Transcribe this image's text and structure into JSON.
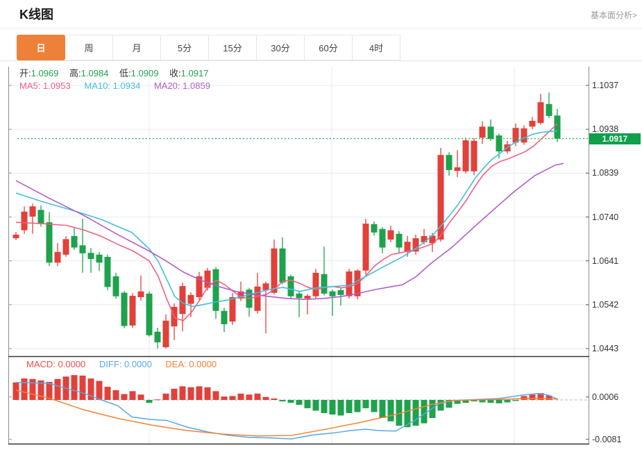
{
  "header": {
    "title": "K线图",
    "link": "基本面分析>"
  },
  "tabs": {
    "items": [
      {
        "label": "日",
        "active": true
      },
      {
        "label": "周",
        "active": false
      },
      {
        "label": "月",
        "active": false
      },
      {
        "label": "5分",
        "active": false
      },
      {
        "label": "15分",
        "active": false
      },
      {
        "label": "30分",
        "active": false
      },
      {
        "label": "60分",
        "active": false
      },
      {
        "label": "4时",
        "active": false
      }
    ]
  },
  "legend": {
    "open_label": "开:",
    "open": "1.0969",
    "high_label": "高:",
    "high": "1.0984",
    "low_label": "低:",
    "low": "1.0909",
    "close_label": "收:",
    "close": "1.0917",
    "ma5_label": "MA5:",
    "ma5": "1.0953",
    "ma10_label": "MA10:",
    "ma10": "1.0934",
    "ma20_label": "MA20:",
    "ma20": "1.0859"
  },
  "macd_legend": {
    "macd_label": "MACD:",
    "macd": "0.0000",
    "diff_label": "DIFF:",
    "diff": "0.0000",
    "dea_label": "DEA:",
    "dea": "0.0000"
  },
  "colors": {
    "up": "#e2403a",
    "down": "#1ea24c",
    "ma5": "#f06080",
    "ma10": "#41bfdc",
    "ma20": "#b45cc8",
    "price_line": "#2db553",
    "badge_bg": "#0fa04a",
    "diff": "#57a8e8",
    "dea": "#f58231",
    "macd_label": "#f24b4b",
    "accent": "#ee8139",
    "value_green": "#21a44d",
    "grid": "#e6ebf0",
    "axis": "#8a8a8a",
    "frame_dark": "#333333",
    "zero_dash": "#aacbe8"
  },
  "chart_data": {
    "type": "candlestick",
    "title": "K线图",
    "price_axis": {
      "labels": [
        "1.1037",
        "1.0938",
        "1.0839",
        "1.0740",
        "1.0641",
        "1.0542",
        "1.0443"
      ],
      "ylim": [
        1.0443,
        1.1037
      ],
      "current_price": "1.0917"
    },
    "macd_axis": {
      "labels": [
        "0.0006",
        "-0.0081"
      ],
      "values": [
        0.0006,
        -0.0081
      ]
    },
    "candles": [
      [
        1.0692,
        1.0706,
        1.0688,
        1.07
      ],
      [
        1.071,
        1.0764,
        1.0702,
        1.0752
      ],
      [
        1.0741,
        1.077,
        1.0702,
        1.0764
      ],
      [
        1.0756,
        1.0766,
        1.0718,
        1.0724
      ],
      [
        1.0728,
        1.0751,
        1.0629,
        1.0637
      ],
      [
        1.0637,
        1.0681,
        1.0629,
        1.0661
      ],
      [
        1.0655,
        1.0697,
        1.065,
        1.069
      ],
      [
        1.0697,
        1.0717,
        1.0666,
        1.0671
      ],
      [
        1.0676,
        1.0736,
        1.0614,
        1.0658
      ],
      [
        1.0659,
        1.067,
        1.0614,
        1.0645
      ],
      [
        1.0655,
        1.0661,
        1.0618,
        1.0637
      ],
      [
        1.065,
        1.0655,
        1.0575,
        1.0582
      ],
      [
        1.0606,
        1.0614,
        1.0556,
        1.0561
      ],
      [
        1.0569,
        1.0573,
        1.0489,
        1.0494
      ],
      [
        1.0495,
        1.0568,
        1.049,
        1.0562
      ],
      [
        1.0559,
        1.0608,
        1.0551,
        1.0572
      ],
      [
        1.0567,
        1.0572,
        1.047,
        1.0473
      ],
      [
        1.0481,
        1.049,
        1.0443,
        1.0457
      ],
      [
        1.0446,
        1.052,
        1.0443,
        1.0506
      ],
      [
        1.0493,
        1.0545,
        1.0462,
        1.0537
      ],
      [
        1.0521,
        1.0592,
        1.0482,
        1.0584
      ],
      [
        1.0544,
        1.057,
        1.0514,
        1.0564
      ],
      [
        1.0559,
        1.0616,
        1.0553,
        1.0606
      ],
      [
        1.058,
        1.0625,
        1.0574,
        1.0619
      ],
      [
        1.0622,
        1.0627,
        1.051,
        1.0528
      ],
      [
        1.0528,
        1.0535,
        1.048,
        1.0498
      ],
      [
        1.0504,
        1.0568,
        1.0496,
        1.0559
      ],
      [
        1.0556,
        1.0594,
        1.055,
        1.0572
      ],
      [
        1.0576,
        1.058,
        1.0515,
        1.0535
      ],
      [
        1.0528,
        1.0614,
        1.0522,
        1.0583
      ],
      [
        1.0575,
        1.0594,
        1.0477,
        1.059
      ],
      [
        1.0569,
        1.0689,
        1.0565,
        1.0669
      ],
      [
        1.0669,
        1.0694,
        1.0588,
        1.0592
      ],
      [
        1.0606,
        1.061,
        1.0555,
        1.0561
      ],
      [
        1.0567,
        1.0572,
        1.0514,
        1.0557
      ],
      [
        1.0556,
        1.0566,
        1.052,
        1.0562
      ],
      [
        1.0561,
        1.0623,
        1.0556,
        1.0614
      ],
      [
        1.0611,
        1.0673,
        1.0563,
        1.0567
      ],
      [
        1.0572,
        1.0576,
        1.0517,
        1.0561
      ],
      [
        1.0575,
        1.0579,
        1.054,
        1.0564
      ],
      [
        1.0561,
        1.0623,
        1.0556,
        1.0617
      ],
      [
        1.0561,
        1.0622,
        1.0554,
        1.0619
      ],
      [
        1.0619,
        1.0736,
        1.061,
        1.0725
      ],
      [
        1.0724,
        1.073,
        1.0698,
        1.0705
      ],
      [
        1.0713,
        1.0717,
        1.0658,
        1.0671
      ],
      [
        1.0689,
        1.072,
        1.0683,
        1.071
      ],
      [
        1.0702,
        1.0708,
        1.0658,
        1.0671
      ],
      [
        1.0661,
        1.0697,
        1.065,
        1.0684
      ],
      [
        1.0662,
        1.07,
        1.0655,
        1.0692
      ],
      [
        1.0683,
        1.0713,
        1.0678,
        1.0697
      ],
      [
        1.0681,
        1.0704,
        1.0661,
        1.0698
      ],
      [
        1.0689,
        1.0896,
        1.0684,
        1.088
      ],
      [
        1.088,
        1.0886,
        1.0833,
        1.0846
      ],
      [
        1.0844,
        1.0891,
        1.083,
        1.0852
      ],
      [
        1.0843,
        1.0919,
        1.0838,
        1.0913
      ],
      [
        1.0843,
        1.0918,
        1.0835,
        1.0912
      ],
      [
        1.0919,
        1.0956,
        1.0905,
        1.0944
      ],
      [
        1.0944,
        1.096,
        1.0912,
        1.0916
      ],
      [
        1.0924,
        1.0928,
        1.0872,
        1.0888
      ],
      [
        1.0888,
        1.0912,
        1.0883,
        1.0904
      ],
      [
        1.0908,
        1.0951,
        1.09,
        1.0941
      ],
      [
        1.0908,
        1.0947,
        1.0903,
        1.094
      ],
      [
        1.0944,
        1.0966,
        1.0938,
        1.0957
      ],
      [
        1.0952,
        1.1018,
        1.0948,
        1.0999
      ],
      [
        1.0995,
        1.1021,
        1.0963,
        1.0968
      ],
      [
        1.0969,
        1.0984,
        1.0909,
        1.0917
      ]
    ],
    "ma_lines": [
      {
        "name": "MA5",
        "points": [
          [
            23,
            1.0728
          ],
          [
            60,
            1.0725
          ],
          [
            96,
            1.0721
          ],
          [
            120,
            1.0711
          ],
          [
            145,
            1.0697
          ],
          [
            170,
            1.0678
          ],
          [
            192,
            1.0663
          ],
          [
            215,
            1.0641
          ],
          [
            228,
            1.0606
          ],
          [
            240,
            1.0556
          ],
          [
            252,
            1.0512
          ],
          [
            264,
            1.0506
          ],
          [
            276,
            1.0525
          ],
          [
            288,
            1.0553
          ],
          [
            300,
            1.0584
          ],
          [
            312,
            1.0597
          ],
          [
            324,
            1.0587
          ],
          [
            336,
            1.0572
          ],
          [
            348,
            1.0559
          ],
          [
            360,
            1.0556
          ],
          [
            372,
            1.0561
          ],
          [
            384,
            1.0565
          ],
          [
            396,
            1.0578
          ],
          [
            408,
            1.0595
          ],
          [
            420,
            1.0597
          ],
          [
            432,
            1.059
          ],
          [
            444,
            1.0581
          ],
          [
            456,
            1.0576
          ],
          [
            468,
            1.0581
          ],
          [
            480,
            1.0583
          ],
          [
            492,
            1.058
          ],
          [
            504,
            1.0583
          ],
          [
            516,
            1.059
          ],
          [
            528,
            1.0609
          ],
          [
            540,
            1.063
          ],
          [
            552,
            1.0644
          ],
          [
            564,
            1.0655
          ],
          [
            576,
            1.0659
          ],
          [
            588,
            1.0663
          ],
          [
            600,
            1.0667
          ],
          [
            612,
            1.0673
          ],
          [
            624,
            1.068
          ],
          [
            636,
            1.07
          ],
          [
            648,
            1.0728
          ],
          [
            660,
            1.0752
          ],
          [
            672,
            1.0778
          ],
          [
            684,
            1.0808
          ],
          [
            696,
            1.0835
          ],
          [
            708,
            1.0854
          ],
          [
            720,
            1.0865
          ],
          [
            732,
            1.0871
          ],
          [
            744,
            1.0879
          ],
          [
            756,
            1.0887
          ],
          [
            768,
            1.0899
          ],
          [
            780,
            1.0916
          ],
          [
            792,
            1.0934
          ],
          [
            803,
            1.095
          ]
        ]
      },
      {
        "name": "MA10",
        "points": [
          [
            23,
            1.0794
          ],
          [
            60,
            1.0775
          ],
          [
            100,
            1.0757
          ],
          [
            145,
            1.0735
          ],
          [
            190,
            1.0705
          ],
          [
            215,
            1.0668
          ],
          [
            228,
            1.064
          ],
          [
            240,
            1.06
          ],
          [
            252,
            1.056
          ],
          [
            264,
            1.0545
          ],
          [
            278,
            1.0538
          ],
          [
            292,
            1.0542
          ],
          [
            310,
            1.0548
          ],
          [
            330,
            1.0553
          ],
          [
            350,
            1.0561
          ],
          [
            372,
            1.057
          ],
          [
            390,
            1.0577
          ],
          [
            408,
            1.0581
          ],
          [
            432,
            1.0572
          ],
          [
            456,
            1.058
          ],
          [
            480,
            1.0583
          ],
          [
            504,
            1.0586
          ],
          [
            527,
            1.0606
          ],
          [
            553,
            1.0628
          ],
          [
            580,
            1.065
          ],
          [
            600,
            1.067
          ],
          [
            612,
            1.0684
          ],
          [
            624,
            1.07
          ],
          [
            636,
            1.0721
          ],
          [
            648,
            1.0744
          ],
          [
            660,
            1.0768
          ],
          [
            672,
            1.0797
          ],
          [
            684,
            1.0826
          ],
          [
            696,
            1.0849
          ],
          [
            708,
            1.0869
          ],
          [
            720,
            1.0883
          ],
          [
            732,
            1.0898
          ],
          [
            744,
            1.091
          ],
          [
            756,
            1.0919
          ],
          [
            768,
            1.0927
          ],
          [
            780,
            1.0931
          ],
          [
            792,
            1.0933
          ],
          [
            803,
            1.0934
          ]
        ]
      },
      {
        "name": "MA20",
        "points": [
          [
            23,
            1.0822
          ],
          [
            70,
            1.0783
          ],
          [
            120,
            1.0744
          ],
          [
            170,
            1.07
          ],
          [
            215,
            1.0663
          ],
          [
            240,
            1.064
          ],
          [
            265,
            1.0615
          ],
          [
            290,
            1.0597
          ],
          [
            315,
            1.0583
          ],
          [
            340,
            1.0572
          ],
          [
            365,
            1.0565
          ],
          [
            390,
            1.056
          ],
          [
            415,
            1.0556
          ],
          [
            440,
            1.0554
          ],
          [
            465,
            1.0556
          ],
          [
            490,
            1.056
          ],
          [
            515,
            1.0567
          ],
          [
            540,
            1.0576
          ],
          [
            565,
            1.0583
          ],
          [
            580,
            1.0587
          ],
          [
            600,
            1.0606
          ],
          [
            620,
            1.0634
          ],
          [
            650,
            1.067
          ],
          [
            680,
            1.0713
          ],
          [
            710,
            1.0755
          ],
          [
            740,
            1.0796
          ],
          [
            770,
            1.0833
          ],
          [
            800,
            1.0857
          ],
          [
            812,
            1.0861
          ]
        ]
      }
    ],
    "macd": {
      "histogram": [
        0.0036,
        0.0044,
        0.0043,
        0.004,
        0.0037,
        0.0043,
        0.0048,
        0.0051,
        0.005,
        0.0044,
        0.0039,
        0.0027,
        0.002,
        0.0012,
        0.0018,
        0.0011,
        -0.0006,
        0.0001,
        0.0013,
        0.0023,
        0.0028,
        0.0026,
        0.0028,
        0.0026,
        0.0018,
        0.0007,
        0.0008,
        0.0013,
        0.0011,
        0.0013,
        0.0006,
        0.0003,
        -0.0003,
        -0.0006,
        -0.001,
        -0.0017,
        -0.0022,
        -0.0027,
        -0.003,
        -0.0032,
        -0.0027,
        -0.0025,
        -0.0017,
        -0.0025,
        -0.0037,
        -0.0044,
        -0.0053,
        -0.0056,
        -0.0053,
        -0.0048,
        -0.0037,
        -0.0022,
        -0.0016,
        -0.0008,
        -0.0006,
        -0.0003,
        -0.0005,
        -0.0006,
        -0.0007,
        -0.0005,
        -0.0002,
        0.0008,
        0.0011,
        0.0014,
        0.0009,
        0.0
      ],
      "diff_points": [
        [
          23,
          0.0036
        ],
        [
          70,
          0.0034
        ],
        [
          120,
          0.0014
        ],
        [
          150,
          -0.0002
        ],
        [
          170,
          -0.0012
        ],
        [
          190,
          -0.0035
        ],
        [
          215,
          -0.004
        ],
        [
          240,
          -0.0042
        ],
        [
          270,
          -0.0056
        ],
        [
          300,
          -0.0066
        ],
        [
          330,
          -0.0073
        ],
        [
          360,
          -0.0077
        ],
        [
          390,
          -0.0078
        ],
        [
          420,
          -0.008
        ],
        [
          450,
          -0.0072
        ],
        [
          480,
          -0.0068
        ],
        [
          505,
          -0.0063
        ],
        [
          527,
          -0.006
        ],
        [
          545,
          -0.0063
        ],
        [
          570,
          -0.0064
        ],
        [
          600,
          -0.004
        ],
        [
          620,
          -0.002
        ],
        [
          632,
          -0.0008
        ],
        [
          655,
          -0.0001
        ],
        [
          690,
          0.0001
        ],
        [
          720,
          0.0003
        ],
        [
          753,
          0.001
        ],
        [
          775,
          0.0013
        ],
        [
          790,
          0.001
        ],
        [
          804,
          0.0001
        ]
      ],
      "dea_points": [
        [
          23,
          0.002
        ],
        [
          70,
          0.0004
        ],
        [
          120,
          -0.002
        ],
        [
          170,
          -0.0038
        ],
        [
          220,
          -0.0052
        ],
        [
          270,
          -0.0063
        ],
        [
          320,
          -0.007
        ],
        [
          370,
          -0.0074
        ],
        [
          420,
          -0.0073
        ],
        [
          470,
          -0.006
        ],
        [
          520,
          -0.0046
        ],
        [
          570,
          -0.003
        ],
        [
          620,
          -0.001
        ],
        [
          653,
          -0.0001
        ],
        [
          690,
          0.0
        ],
        [
          720,
          0.0001
        ],
        [
          760,
          0.0003
        ],
        [
          804,
          0.0002
        ]
      ]
    }
  }
}
